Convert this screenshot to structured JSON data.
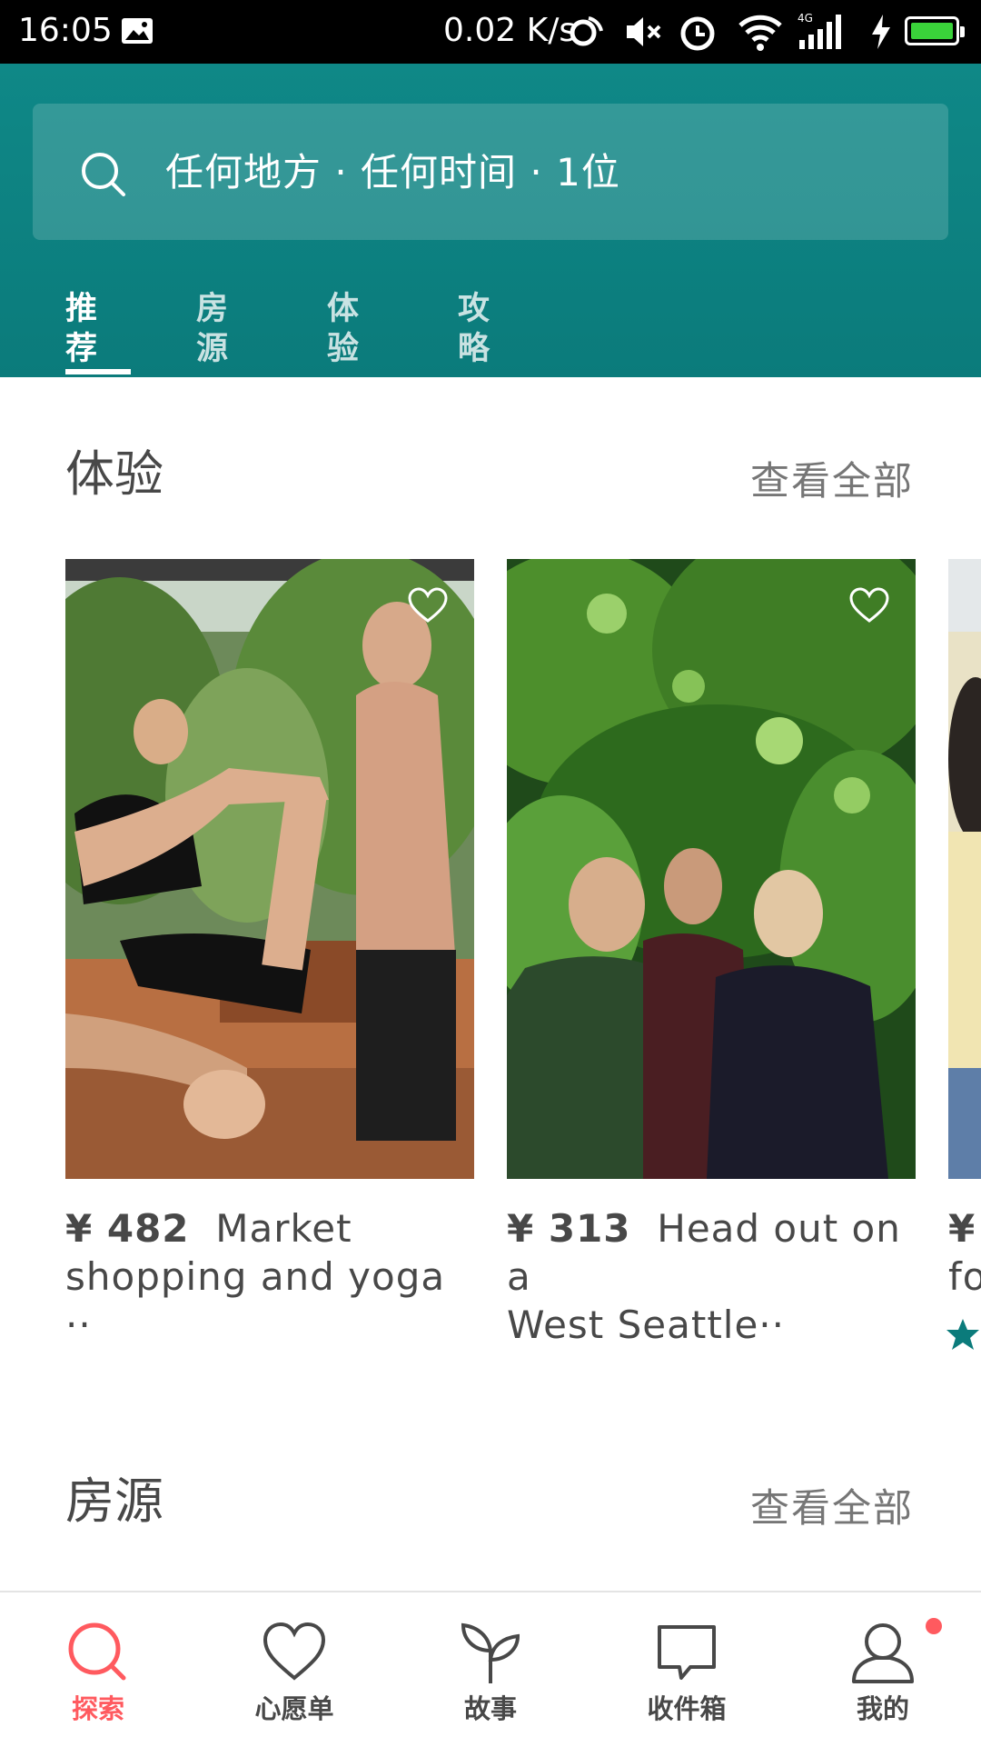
{
  "status_bar": {
    "time": "16:05",
    "net_speed": "0.02 K/s",
    "network": "4G"
  },
  "header": {
    "search_placeholder": "任何地方 · 任何时间 · 1位",
    "tabs": [
      {
        "label": "推荐",
        "active": true
      },
      {
        "label": "房源",
        "active": false
      },
      {
        "label": "体验",
        "active": false
      },
      {
        "label": "攻略",
        "active": false
      }
    ]
  },
  "experiences": {
    "title": "体验",
    "see_all": "查看全部",
    "cards": [
      {
        "price": "¥ 482",
        "title_line1": "Market",
        "title_line2": "shopping and yoga ··"
      },
      {
        "price": "¥ 313",
        "title_line1": "Head out on a",
        "title_line2": "West Seattle··"
      },
      {
        "price": "¥",
        "title_line1": "",
        "title_line2": "fo"
      }
    ]
  },
  "homes": {
    "title": "房源",
    "see_all": "查看全部"
  },
  "bottom_nav": [
    {
      "label": "探索",
      "icon": "search-icon",
      "active": true
    },
    {
      "label": "心愿单",
      "icon": "heart-icon",
      "active": false
    },
    {
      "label": "故事",
      "icon": "sprout-icon",
      "active": false
    },
    {
      "label": "收件箱",
      "icon": "chat-bubble-icon",
      "active": false
    },
    {
      "label": "我的",
      "icon": "profile-icon",
      "active": false
    }
  ],
  "colors": {
    "header": "#0f8887",
    "accent": "#ff5a5f",
    "star": "#0b7b7b"
  }
}
